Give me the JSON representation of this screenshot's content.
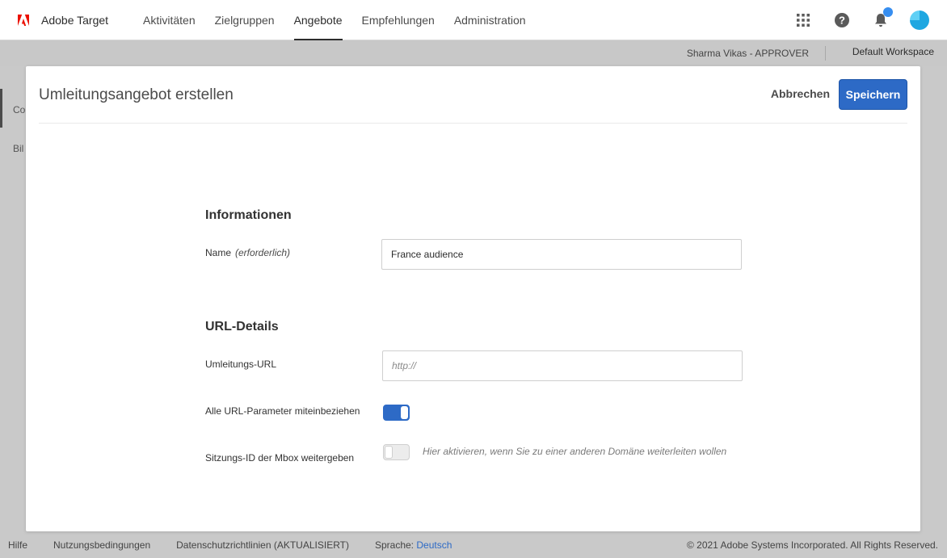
{
  "app": {
    "name": "Adobe Target",
    "logo_icon": "adobe-logo-icon",
    "accent": "#2d6ac6",
    "brand_red": "#eb1000"
  },
  "nav": {
    "items": [
      {
        "label": "Aktivitäten",
        "active": false
      },
      {
        "label": "Zielgruppen",
        "active": false
      },
      {
        "label": "Angebote",
        "active": true
      },
      {
        "label": "Empfehlungen",
        "active": false
      },
      {
        "label": "Administration",
        "active": false
      }
    ]
  },
  "top_icons": [
    "apps-grid-icon",
    "help-icon",
    "bell-icon",
    "avatar"
  ],
  "subbar": {
    "user": "Sharma Vikas - APPROVER",
    "workspace": "Default Workspace"
  },
  "side": {
    "items": [
      "Co",
      "Bil"
    ]
  },
  "modal": {
    "title": "Umleitungsangebot erstellen",
    "cancel_label": "Abbrechen",
    "save_label": "Speichern",
    "info_section": {
      "title": "Informationen",
      "name_label": "Name",
      "name_required": "(erforderlich)",
      "name_value": "France audience"
    },
    "url_section": {
      "title": "URL-Details",
      "redirect_label": "Umleitungs-URL",
      "redirect_placeholder": "http://",
      "redirect_value": "",
      "include_params_label": "Alle URL-Parameter miteinbeziehen",
      "include_params_on": true,
      "pass_session_label": "Sitzungs-ID der Mbox weitergeben",
      "pass_session_on": false,
      "pass_session_hint": "Hier aktivieren, wenn Sie zu einer anderen Domäne weiterleiten wollen"
    }
  },
  "footer": {
    "help": "Hilfe",
    "terms": "Nutzungsbedingungen",
    "privacy": "Datenschutzrichtlinien (AKTUALISIERT)",
    "language_label": "Sprache:",
    "language_value": "Deutsch",
    "copyright": "© 2021 Adobe Systems Incorporated. All Rights Reserved."
  }
}
